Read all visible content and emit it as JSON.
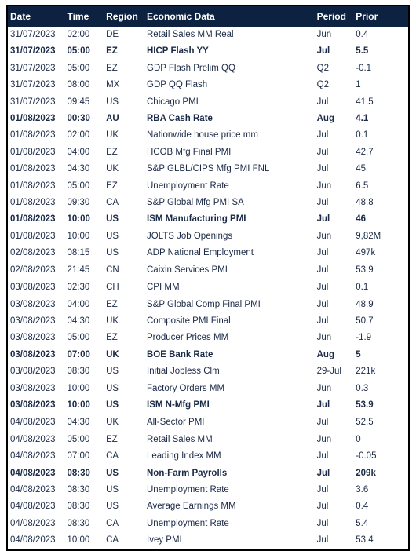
{
  "table": {
    "headers": {
      "date": "Date",
      "time": "Time",
      "region": "Region",
      "economic_data": "Economic Data",
      "period": "Period",
      "prior": "Prior"
    },
    "colors": {
      "header_background": "#0d2240",
      "header_text": "#ffffff",
      "body_text": "#1b2a47",
      "highlight_text": "#00c9a7",
      "border": "#000000",
      "background": "#ffffff"
    },
    "rows": [
      {
        "date": "31/07/2023",
        "time": "02:00",
        "region": "DE",
        "economic_data": "Retail Sales MM Real",
        "period": "Jun",
        "prior": "0.4",
        "style": "normal",
        "group_start": false
      },
      {
        "date": "31/07/2023",
        "time": "05:00",
        "region": "EZ",
        "economic_data": "HICP Flash YY",
        "period": "Jul",
        "prior": "5.5",
        "style": "bold",
        "group_start": false
      },
      {
        "date": "31/07/2023",
        "time": "05:00",
        "region": "EZ",
        "economic_data": "GDP Flash Prelim QQ",
        "period": "Q2",
        "prior": "-0.1",
        "style": "normal",
        "group_start": false
      },
      {
        "date": "31/07/2023",
        "time": "08:00",
        "region": "MX",
        "economic_data": "GDP QQ Flash",
        "period": "Q2",
        "prior": "1",
        "style": "normal",
        "group_start": false
      },
      {
        "date": "31/07/2023",
        "time": "09:45",
        "region": "US",
        "economic_data": "Chicago PMI",
        "period": "Jul",
        "prior": "41.5",
        "style": "normal",
        "group_start": false
      },
      {
        "date": "01/08/2023",
        "time": "00:30",
        "region": "AU",
        "economic_data": "RBA Cash Rate",
        "period": "Aug",
        "prior": "4.1",
        "style": "highlight",
        "group_start": false
      },
      {
        "date": "01/08/2023",
        "time": "02:00",
        "region": "UK",
        "economic_data": "Nationwide house price mm",
        "period": "Jul",
        "prior": "0.1",
        "style": "normal",
        "group_start": false
      },
      {
        "date": "01/08/2023",
        "time": "04:00",
        "region": "EZ",
        "economic_data": "HCOB Mfg Final PMI",
        "period": "Jul",
        "prior": "42.7",
        "style": "normal",
        "group_start": false
      },
      {
        "date": "01/08/2023",
        "time": "04:30",
        "region": "UK",
        "economic_data": "S&P GLBL/CIPS Mfg PMI FNL",
        "period": "Jul",
        "prior": "45",
        "style": "normal",
        "group_start": false
      },
      {
        "date": "01/08/2023",
        "time": "05:00",
        "region": "EZ",
        "economic_data": "Unemployment Rate",
        "period": "Jun",
        "prior": "6.5",
        "style": "normal",
        "group_start": false
      },
      {
        "date": "01/08/2023",
        "time": "09:30",
        "region": "CA",
        "economic_data": "S&P Global Mfg PMI SA",
        "period": "Jul",
        "prior": "48.8",
        "style": "normal",
        "group_start": false
      },
      {
        "date": "01/08/2023",
        "time": "10:00",
        "region": "US",
        "economic_data": "ISM Manufacturing PMI",
        "period": "Jul",
        "prior": "46",
        "style": "bold",
        "group_start": false
      },
      {
        "date": "01/08/2023",
        "time": "10:00",
        "region": "US",
        "economic_data": "JOLTS Job Openings",
        "period": "Jun",
        "prior": "9,82M",
        "style": "normal",
        "group_start": false
      },
      {
        "date": "02/08/2023",
        "time": "08:15",
        "region": "US",
        "economic_data": "ADP National Employment",
        "period": "Jul",
        "prior": "497k",
        "style": "normal",
        "group_start": false
      },
      {
        "date": "02/08/2023",
        "time": "21:45",
        "region": "CN",
        "economic_data": "Caixin Services PMI",
        "period": "Jul",
        "prior": "53.9",
        "style": "normal",
        "group_start": false
      },
      {
        "date": "03/08/2023",
        "time": "02:30",
        "region": "CH",
        "economic_data": "CPI MM",
        "period": "Jul",
        "prior": "0.1",
        "style": "normal",
        "group_start": true
      },
      {
        "date": "03/08/2023",
        "time": "04:00",
        "region": "EZ",
        "economic_data": "S&P Global Comp Final PMI",
        "period": "Jul",
        "prior": "48.9",
        "style": "normal",
        "group_start": false
      },
      {
        "date": "03/08/2023",
        "time": "04:30",
        "region": "UK",
        "economic_data": "Composite PMI Final",
        "period": "Jul",
        "prior": "50.7",
        "style": "normal",
        "group_start": false
      },
      {
        "date": "03/08/2023",
        "time": "05:00",
        "region": "EZ",
        "economic_data": "Producer Prices MM",
        "period": "Jun",
        "prior": "-1.9",
        "style": "normal",
        "group_start": false
      },
      {
        "date": "03/08/2023",
        "time": "07:00",
        "region": "UK",
        "economic_data": "BOE Bank Rate",
        "period": "Aug",
        "prior": "5",
        "style": "highlight",
        "group_start": false
      },
      {
        "date": "03/08/2023",
        "time": "08:30",
        "region": "US",
        "economic_data": "Initial Jobless Clm",
        "period": "29-Jul",
        "prior": "221k",
        "style": "normal",
        "group_start": false
      },
      {
        "date": "03/08/2023",
        "time": "10:00",
        "region": "US",
        "economic_data": "Factory Orders MM",
        "period": "Jun",
        "prior": "0.3",
        "style": "normal",
        "group_start": false
      },
      {
        "date": "03/08/2023",
        "time": "10:00",
        "region": "US",
        "economic_data": "ISM N-Mfg PMI",
        "period": "Jul",
        "prior": "53.9",
        "style": "bold",
        "group_start": false
      },
      {
        "date": "04/08/2023",
        "time": "04:30",
        "region": "UK",
        "economic_data": "All-Sector PMI",
        "period": "Jul",
        "prior": "52.5",
        "style": "normal",
        "group_start": true
      },
      {
        "date": "04/08/2023",
        "time": "05:00",
        "region": "EZ",
        "economic_data": "Retail Sales MM",
        "period": "Jun",
        "prior": "0",
        "style": "normal",
        "group_start": false
      },
      {
        "date": "04/08/2023",
        "time": "07:00",
        "region": "CA",
        "economic_data": "Leading Index MM",
        "period": "Jul",
        "prior": "-0.05",
        "style": "normal",
        "group_start": false
      },
      {
        "date": "04/08/2023",
        "time": "08:30",
        "region": "US",
        "economic_data": "Non-Farm Payrolls",
        "period": "Jul",
        "prior": "209k",
        "style": "bold",
        "group_start": false
      },
      {
        "date": "04/08/2023",
        "time": "08:30",
        "region": "US",
        "economic_data": "Unemployment Rate",
        "period": "Jul",
        "prior": "3.6",
        "style": "normal",
        "group_start": false
      },
      {
        "date": "04/08/2023",
        "time": "08:30",
        "region": "US",
        "economic_data": "Average Earnings MM",
        "period": "Jul",
        "prior": "0.4",
        "style": "normal",
        "group_start": false
      },
      {
        "date": "04/08/2023",
        "time": "08:30",
        "region": "CA",
        "economic_data": "Unemployment Rate",
        "period": "Jul",
        "prior": "5.4",
        "style": "normal",
        "group_start": false
      },
      {
        "date": "04/08/2023",
        "time": "10:00",
        "region": "CA",
        "economic_data": "Ivey PMI",
        "period": "Jul",
        "prior": "53.4",
        "style": "normal",
        "group_start": false
      }
    ]
  }
}
